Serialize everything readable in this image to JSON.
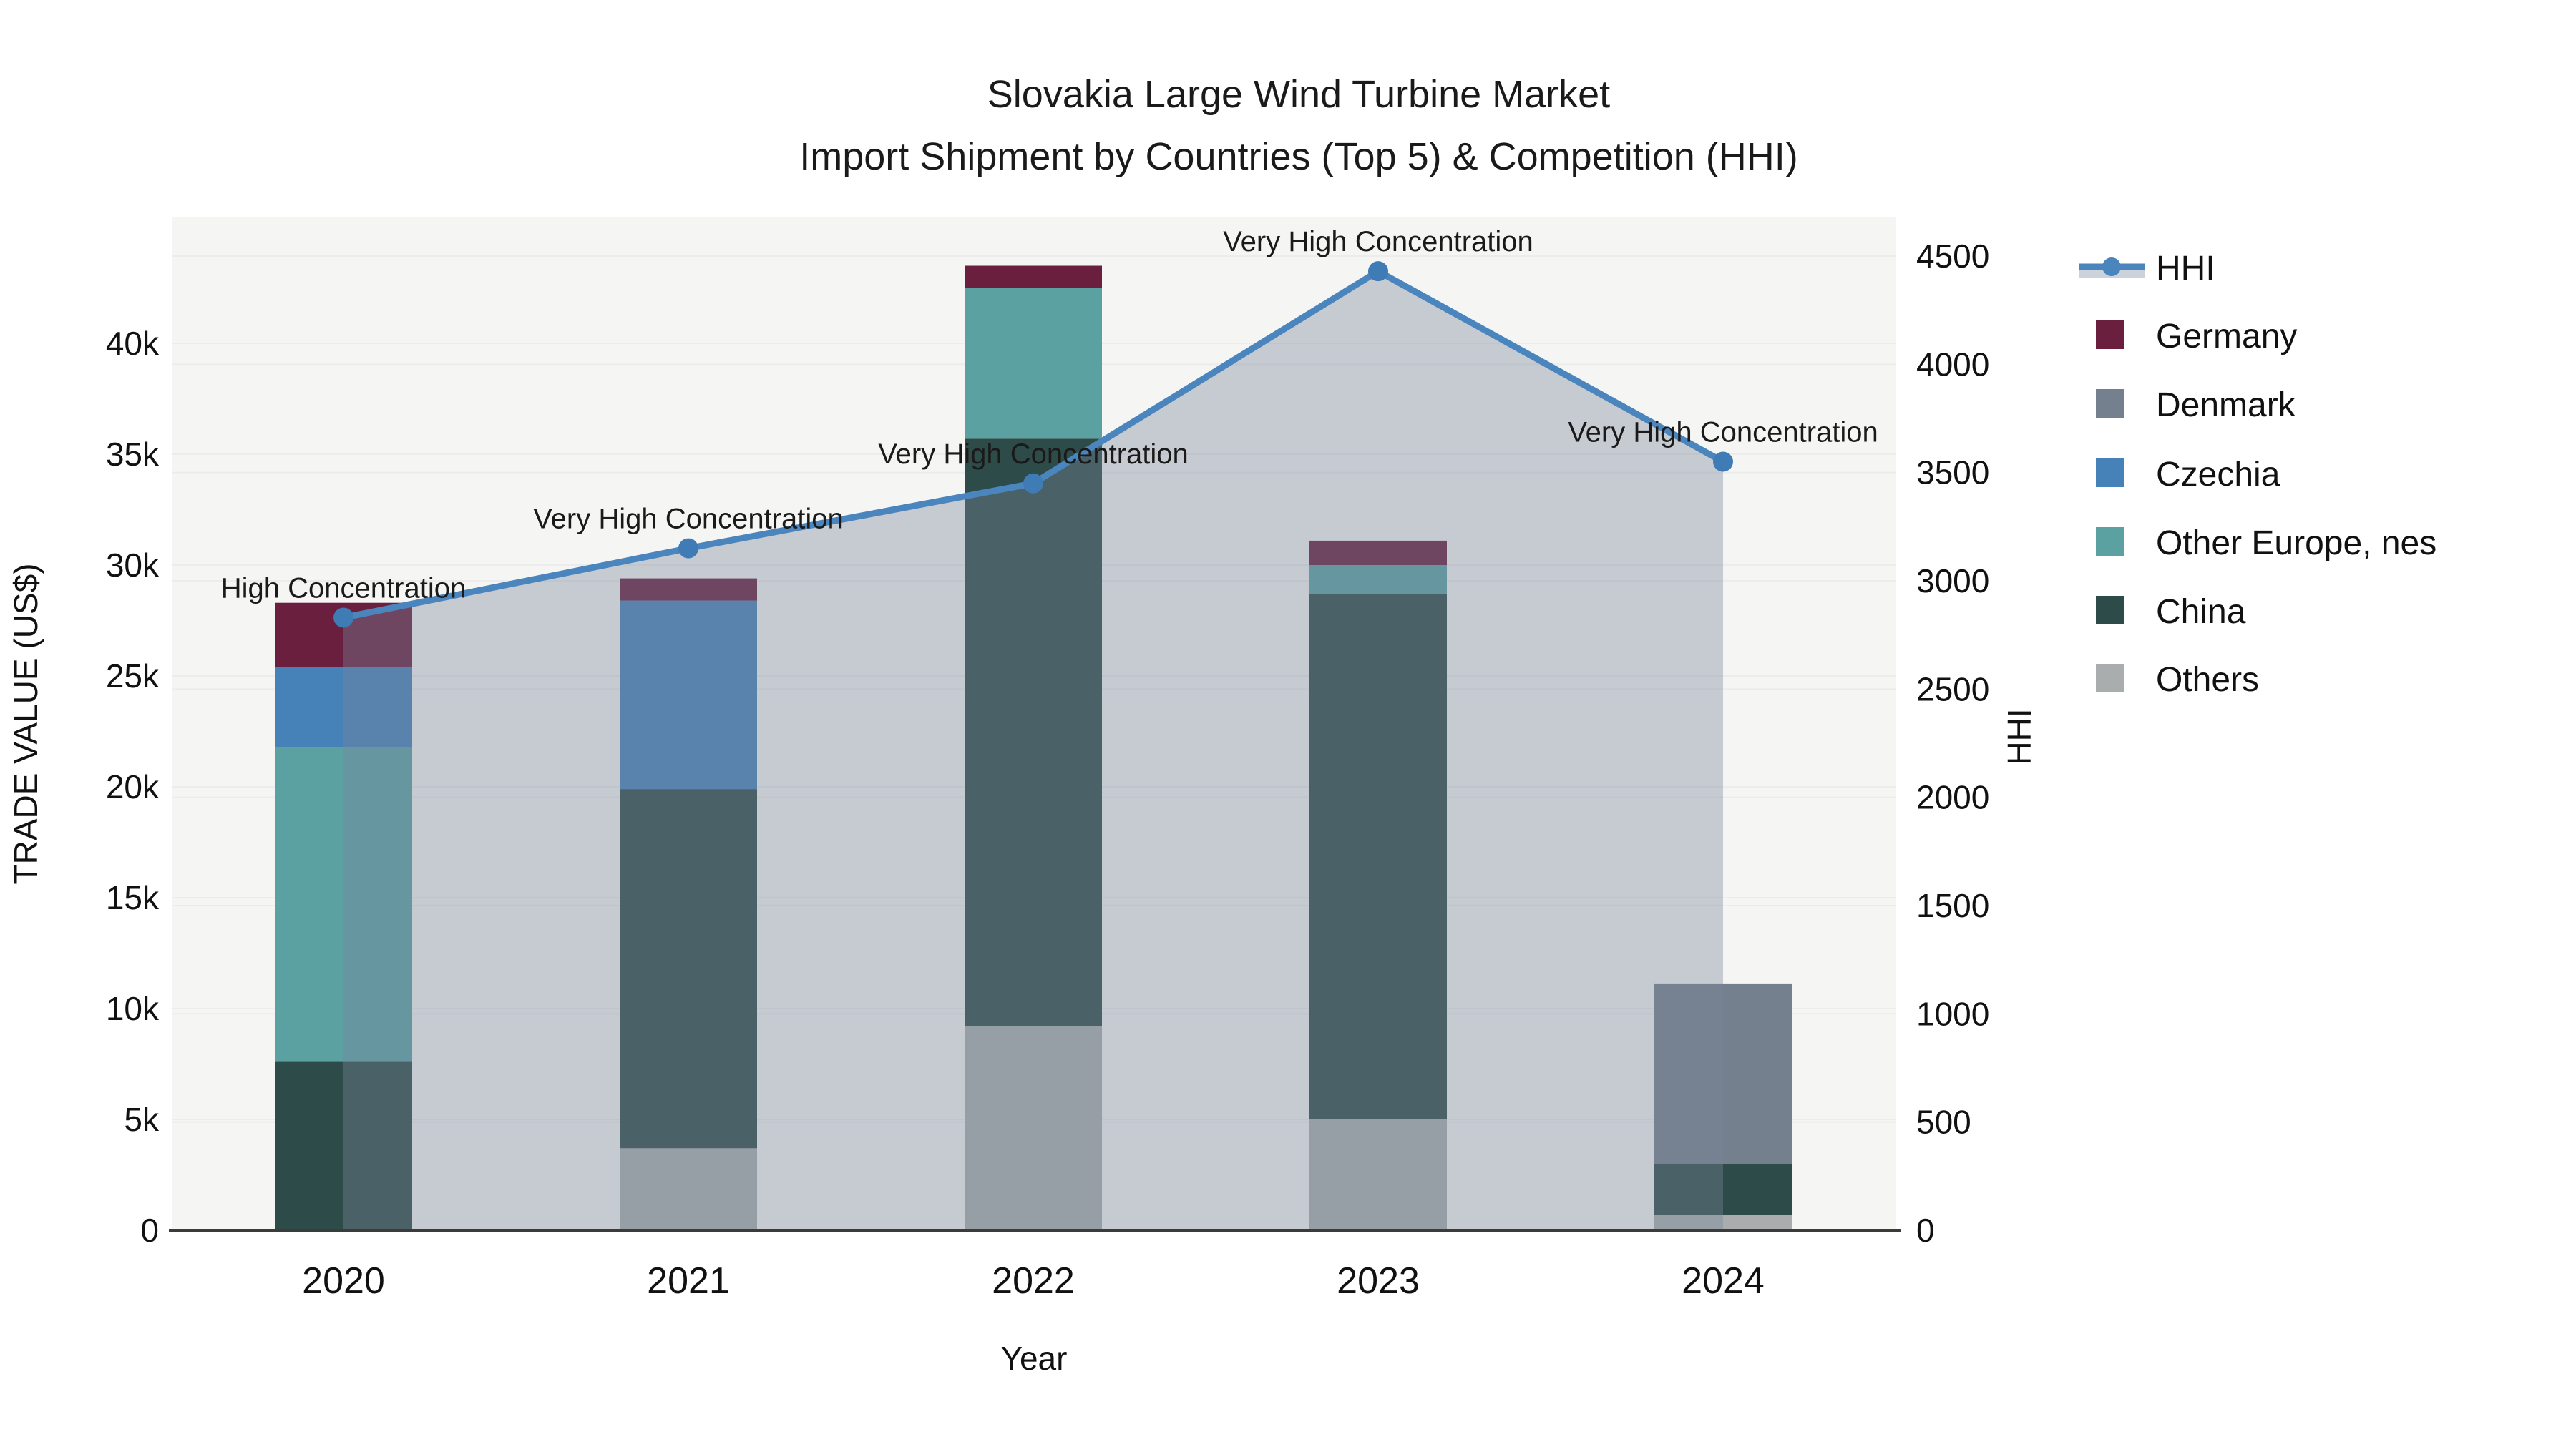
{
  "chart_data": {
    "type": "bar",
    "stacked": true,
    "title_line1": "Slovakia Large Wind Turbine Market",
    "title_line2": "Import Shipment by Countries (Top 5) & Competition (HHI)",
    "x_title": "Year",
    "categories": [
      "2020",
      "2021",
      "2022",
      "2023",
      "2024"
    ],
    "series": [
      {
        "name": "Others",
        "color": "#a9adad",
        "values": [
          0,
          3700,
          9200,
          5000,
          700
        ]
      },
      {
        "name": "China",
        "color": "#2d4b48",
        "values": [
          7600,
          16200,
          26500,
          23700,
          2300
        ]
      },
      {
        "name": "Other Europe, nes",
        "color": "#5ba1a2",
        "values": [
          14200,
          0,
          6800,
          1300,
          0
        ]
      },
      {
        "name": "Czechia",
        "color": "#4682b8",
        "values": [
          3600,
          8500,
          0,
          0,
          0
        ]
      },
      {
        "name": "Denmark",
        "color": "#74808d",
        "values": [
          0,
          0,
          0,
          0,
          8100
        ]
      },
      {
        "name": "Germany",
        "color": "#6a1f3e",
        "values": [
          2900,
          1000,
          1000,
          1100,
          0
        ]
      }
    ],
    "line_series": {
      "name": "HHI",
      "color": "#4a85bd",
      "marker_color": "#3f7cb5",
      "area_fill": "rgba(120,135,155,0.38)",
      "values": [
        2830,
        3150,
        3450,
        4430,
        3550
      ]
    },
    "annotations": [
      {
        "year": "2020",
        "label": "High Concentration"
      },
      {
        "year": "2021",
        "label": "Very High Concentration"
      },
      {
        "year": "2022",
        "label": "Very High Concentration"
      },
      {
        "year": "2023",
        "label": "Very High Concentration"
      },
      {
        "year": "2024",
        "label": "Very High Concentration"
      }
    ],
    "y_left": {
      "title": "TRADE VALUE (US$)",
      "ticks": [
        "0",
        "5k",
        "10k",
        "15k",
        "20k",
        "25k",
        "30k",
        "35k",
        "40k"
      ],
      "tick_values": [
        0,
        5000,
        10000,
        15000,
        20000,
        25000,
        30000,
        35000,
        40000
      ],
      "range": [
        0,
        45700
      ]
    },
    "y_right": {
      "title": "HHI",
      "ticks": [
        "0",
        "500",
        "1000",
        "1500",
        "2000",
        "2500",
        "3000",
        "3500",
        "4000",
        "4500"
      ],
      "tick_values": [
        0,
        500,
        1000,
        1500,
        2000,
        2500,
        3000,
        3500,
        4000,
        4500
      ],
      "range": [
        0,
        4680
      ]
    },
    "legend": {
      "position": "right",
      "items": [
        {
          "label": "HHI",
          "type": "line",
          "color": "#4a85bd"
        },
        {
          "label": "Germany",
          "type": "box",
          "color": "#6a1f3e"
        },
        {
          "label": "Denmark",
          "type": "box",
          "color": "#74808d"
        },
        {
          "label": "Czechia",
          "type": "box",
          "color": "#4682b8"
        },
        {
          "label": "Other Europe, nes",
          "type": "box",
          "color": "#5ba1a2"
        },
        {
          "label": "China",
          "type": "box",
          "color": "#2d4b48"
        },
        {
          "label": "Others",
          "type": "box",
          "color": "#a9adad"
        }
      ]
    },
    "style": {
      "plot_bg": "#f5f5f4",
      "grid_color": "#ececec",
      "axis_line_color": "#3b3b3b"
    },
    "grid": true
  }
}
